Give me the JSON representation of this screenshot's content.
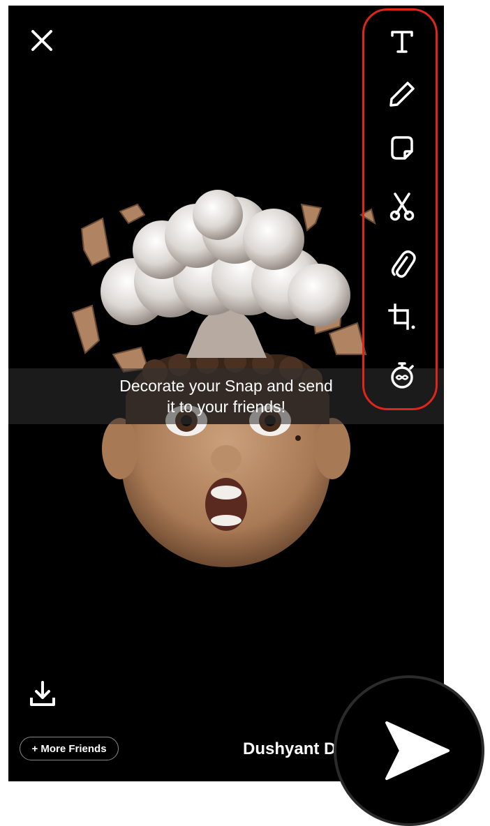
{
  "screen": {
    "caption": {
      "line1": "Decorate your Snap and send",
      "line2": "it to your friends!"
    },
    "toolbar": {
      "tools": [
        "text-tool",
        "pen-tool",
        "sticker-tool",
        "scissors-tool",
        "attach-tool",
        "crop-tool",
        "timer-tool"
      ],
      "highlight_color": "#e0251b"
    },
    "footer": {
      "more_friends_label": "+ More Friends",
      "recipient_label": "Dushyant D"
    }
  },
  "colors": {
    "background": "#000000",
    "skin": "#b88760",
    "cloud": "#e6e2df"
  }
}
